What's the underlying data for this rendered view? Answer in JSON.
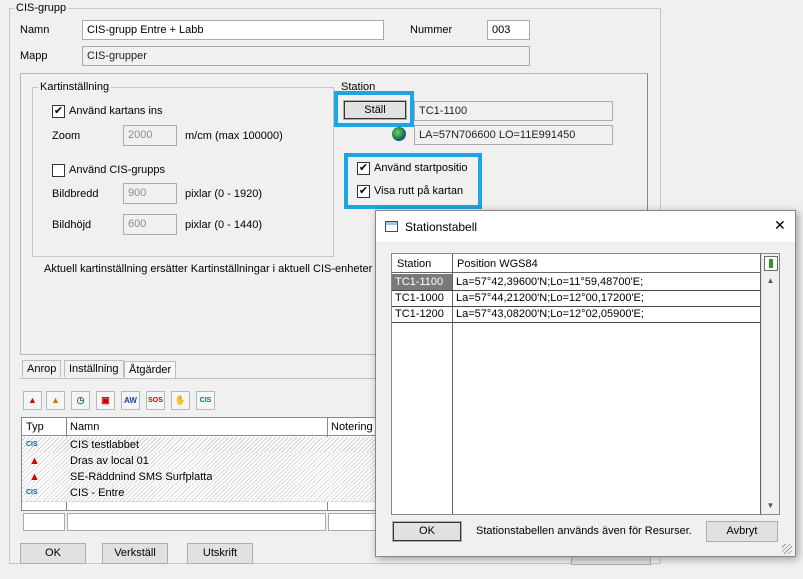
{
  "cis_group": {
    "legend": "CIS-grupp",
    "name_label": "Namn",
    "name_value": "CIS-grupp Entre + Labb",
    "number_label": "Nummer",
    "number_value": "003",
    "folder_label": "Mapp",
    "folder_value": "CIS-grupper"
  },
  "map_settings": {
    "legend": "Kartinställning",
    "use_map_check": "✔",
    "use_map_label": "Använd kartans ins",
    "zoom_label": "Zoom",
    "zoom_value": "2000",
    "zoom_unit": "m/cm (max 100000)",
    "use_cis_label": "Använd CIS-grupps",
    "width_label": "Bildbredd",
    "width_value": "900",
    "width_unit": "pixlar  (0 - 1920)",
    "height_label": "Bildhöjd",
    "height_value": "600",
    "height_unit": "pixlar  (0 - 1440)",
    "info_text": "Aktuell kartinställning ersätter Kartinställningar i aktuell CIS-enheter"
  },
  "station": {
    "legend": "Station",
    "set_button": "Ställ",
    "station_value": "TC1-1100",
    "coords_value": "LA=57N706600 LO=11E991450",
    "start_check": "✔",
    "start_label": "Använd startpositio",
    "route_check": "✔",
    "route_label": "Visa rutt på kartan"
  },
  "tabs": [
    "Anrop",
    "Inställning",
    "Åtgärder"
  ],
  "toolbar_icons": [
    "alarm-icon",
    "alarm-add-icon",
    "clock-icon",
    "vehicles-icon",
    "text-icon",
    "sos-icon",
    "hand-icon",
    "cis-icon"
  ],
  "toolbar_glyphs": [
    "▲",
    "▲",
    "◷",
    "▣",
    "AW",
    "SOS",
    "✋",
    "CIS"
  ],
  "actions_table": {
    "headers": [
      "Typ",
      "Namn",
      "Notering"
    ],
    "rows": [
      {
        "icon": "CIS",
        "name": "CIS testlabbet"
      },
      {
        "icon": "▲",
        "name": "Dras av local 01"
      },
      {
        "icon": "▲",
        "name": "SE-Räddnind SMS Surfplatta"
      },
      {
        "icon": "CIS",
        "name": "CIS - Entre"
      }
    ]
  },
  "bottom_buttons": {
    "ok": "OK",
    "apply": "Verkställ",
    "print": "Utskrift"
  },
  "station_dialog": {
    "title": "Stationstabell",
    "close": "✕",
    "headers": [
      "Station",
      "Position WGS84"
    ],
    "rows": [
      {
        "station": "TC1-1100",
        "position": "La=57°42,39600'N;Lo=11°59,48700'E;"
      },
      {
        "station": "TC1-1000",
        "position": "La=57°44,21200'N;Lo=12°00,17200'E;"
      },
      {
        "station": "TC1-1200",
        "position": "La=57°43,08200'N;Lo=12°02,05900'E;"
      }
    ],
    "ok": "OK",
    "note": "Stationstabellen används även för Resurser.",
    "cancel": "Avbryt"
  },
  "colors": {
    "highlight": "#1ca4e6",
    "selection": "#7a7a7a"
  }
}
